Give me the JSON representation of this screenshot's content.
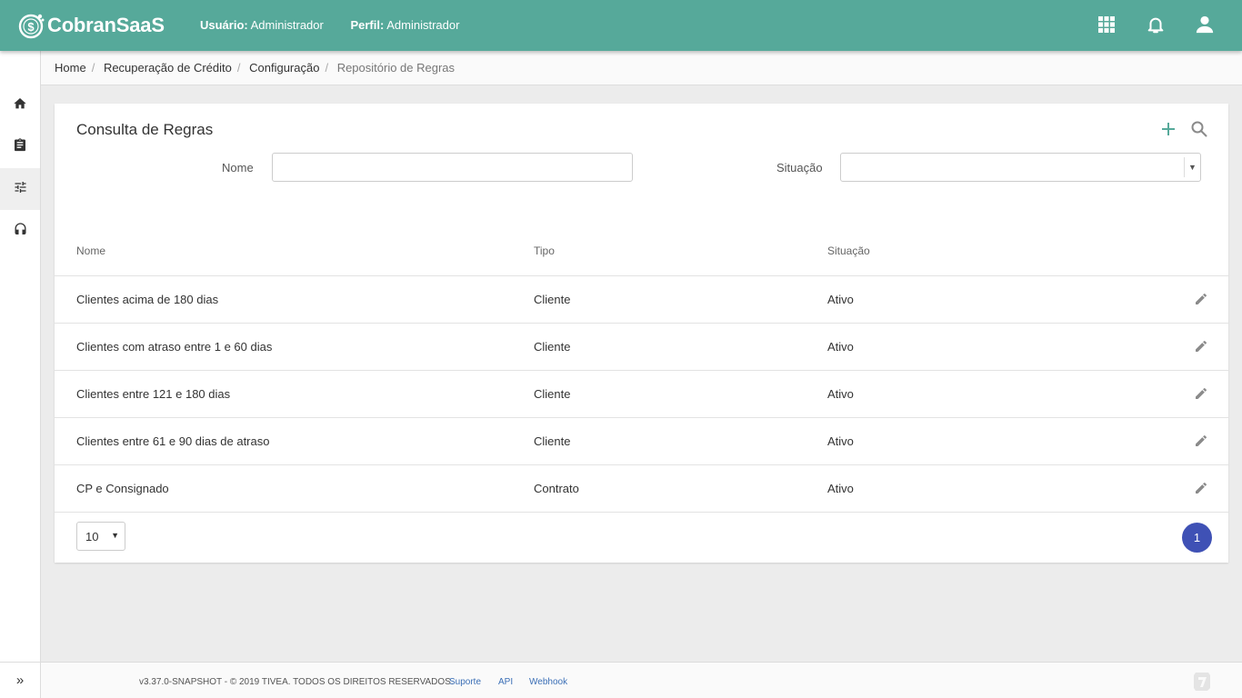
{
  "app": {
    "name": "CobranSaaS"
  },
  "header": {
    "user_label": "Usuário:",
    "user_value": "Administrador",
    "profile_label": "Perfil:",
    "profile_value": "Administrador",
    "icons": [
      "apps-grid-icon",
      "notification-bell-icon",
      "account-icon"
    ]
  },
  "sidebar": {
    "items": [
      "home-icon",
      "clipboard-icon",
      "settings-sliders-icon",
      "headset-icon"
    ],
    "active": "settings-sliders-icon",
    "toggle": "»"
  },
  "breadcrumb": {
    "items": [
      "Home",
      "Recuperação de Crédito",
      "Configuração"
    ],
    "current": "Repositório de Regras"
  },
  "card": {
    "title": "Consulta de Regras",
    "actions": [
      "add-icon",
      "search-icon"
    ]
  },
  "filters": {
    "name_label": "Nome",
    "name_value": "",
    "status_label": "Situação",
    "status_value": ""
  },
  "table": {
    "columns": [
      "Nome",
      "Tipo",
      "Situação"
    ],
    "rows": [
      {
        "nome": "Clientes acima de 180 dias",
        "tipo": "Cliente",
        "situacao": "Ativo"
      },
      {
        "nome": "Clientes com atraso entre 1 e 60 dias",
        "tipo": "Cliente",
        "situacao": "Ativo"
      },
      {
        "nome": "Clientes entre 121 e 180 dias",
        "tipo": "Cliente",
        "situacao": "Ativo"
      },
      {
        "nome": "Clientes entre 61 e 90 dias de atraso",
        "tipo": "Cliente",
        "situacao": "Ativo"
      },
      {
        "nome": "CP e Consignado",
        "tipo": "Contrato",
        "situacao": "Ativo"
      }
    ]
  },
  "pagination": {
    "page_size": "10",
    "current_page": "1"
  },
  "footer": {
    "copyright": "v3.37.0-SNAPSHOT - © 2019 TIVEA. TODOS OS DIREITOS RESERVADOS.",
    "links": [
      "Suporte",
      "API",
      "Webhook"
    ]
  },
  "colors": {
    "header_bg": "#56a99a",
    "page_button": "#3f51b5",
    "link": "#3b6fb6"
  }
}
